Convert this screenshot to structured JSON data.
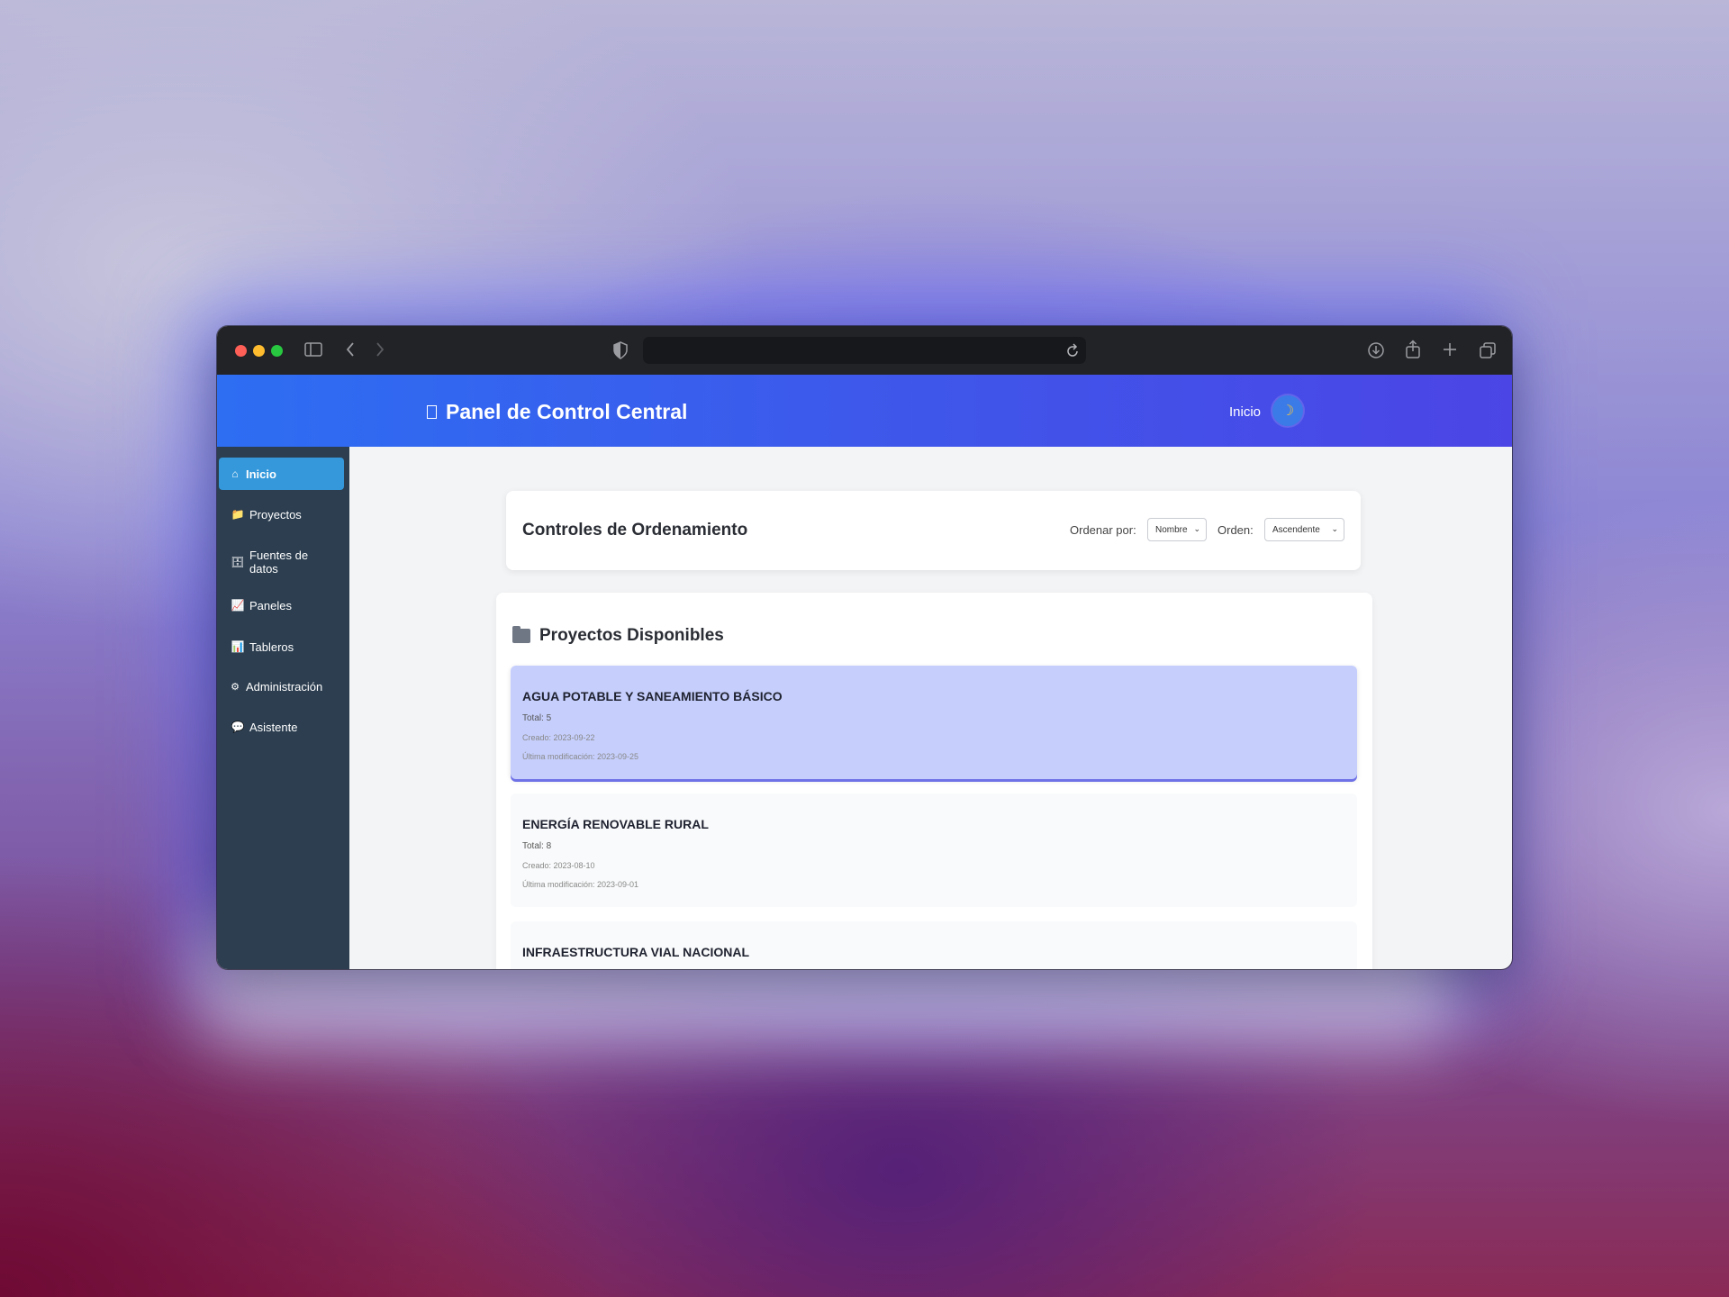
{
  "app": {
    "title": "Panel de Control Central",
    "nav_link": "Inicio",
    "theme_icon": "moon-icon"
  },
  "sidebar": {
    "items": [
      {
        "label": "Inicio",
        "icon": "home-icon",
        "glyph": "⌂",
        "active": true
      },
      {
        "label": "Proyectos",
        "icon": "folder-icon",
        "glyph": "📁"
      },
      {
        "label": "Fuentes de datos",
        "icon": "database-icon",
        "glyph": "🗄"
      },
      {
        "label": "Paneles",
        "icon": "chart-line-icon",
        "glyph": "📈"
      },
      {
        "label": "Tableros",
        "icon": "bar-chart-icon",
        "glyph": "📊"
      },
      {
        "label": "Administración",
        "icon": "gear-icon",
        "glyph": "⚙"
      },
      {
        "label": "Asistente",
        "icon": "chat-bubble-icon",
        "glyph": "💬"
      }
    ]
  },
  "controls": {
    "title": "Controles de Ordenamiento",
    "sort_by_label": "Ordenar por:",
    "sort_by_value": "Nombre",
    "order_label": "Orden:",
    "order_value": "Ascendente"
  },
  "projects": {
    "title": "Proyectos Disponibles",
    "items": [
      {
        "name": "AGUA POTABLE Y SANEAMIENTO BÁSICO",
        "total": "Total: 5",
        "created": "Creado: 2023-09-22",
        "modified": "Última modificación: 2023-09-25",
        "selected": true
      },
      {
        "name": "ENERGÍA RENOVABLE RURAL",
        "total": "Total: 8",
        "created": "Creado: 2023-08-10",
        "modified": "Última modificación: 2023-09-01"
      },
      {
        "name": "INFRAESTRUCTURA VIAL NACIONAL"
      }
    ]
  },
  "colors": {
    "header_start": "#2d6ef3",
    "header_end": "#4b45e6",
    "sidebar_bg": "#2c3e50",
    "sidebar_active": "#3498db",
    "selected_card": "#c6cffc"
  }
}
